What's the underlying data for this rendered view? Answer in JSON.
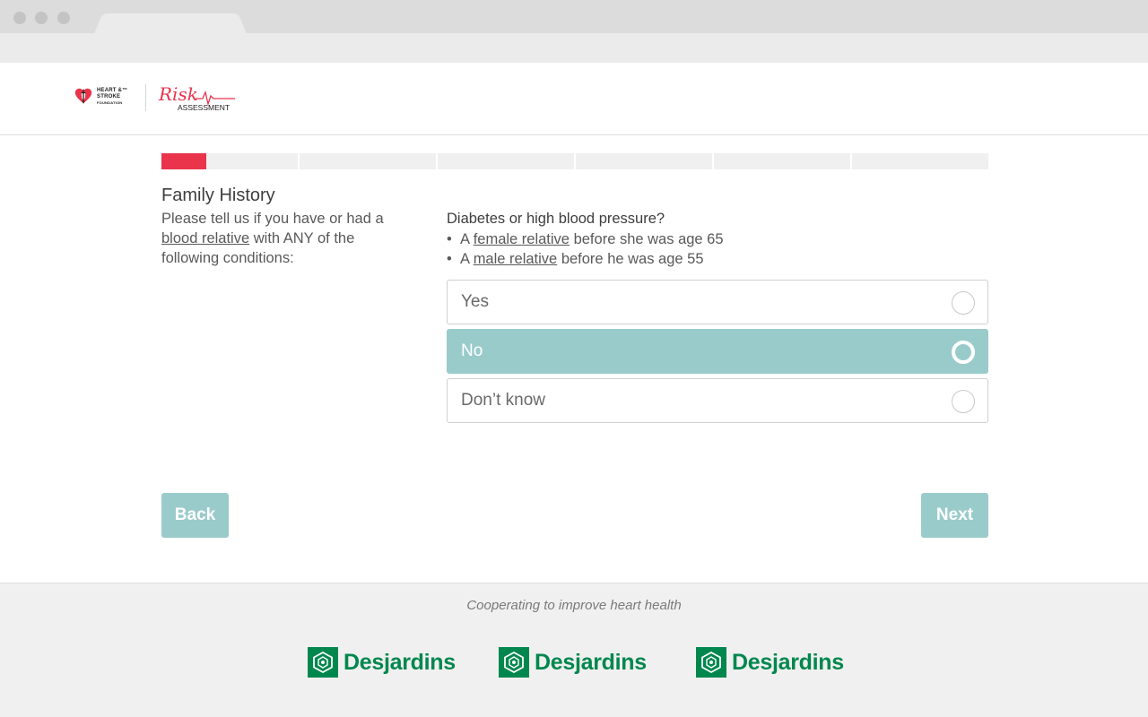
{
  "header": {
    "hsf_logo_lines": [
      "HEART &™",
      "STROKE",
      "FOUNDATION"
    ],
    "risk_logo_script": "Risk",
    "risk_logo_sub": "ASSESSMENT"
  },
  "progress": {
    "segments": 6,
    "current_fraction_of_first_segment": 0.33,
    "fill_color": "#e9344c"
  },
  "section": {
    "title": "Family History",
    "desc_part1": "Please tell us if you have or had a ",
    "desc_link": "blood relative",
    "desc_part2": " with ANY of the following conditions:"
  },
  "question": {
    "title": "Diabetes or high blood pressure?",
    "bullet1_pre": "A ",
    "bullet1_link": "female relative",
    "bullet1_post": " before she was age 65",
    "bullet2_pre": "A ",
    "bullet2_link": "male relative",
    "bullet2_post": " before he was age 55"
  },
  "options": [
    {
      "label": "Yes",
      "selected": false
    },
    {
      "label": "No",
      "selected": true
    },
    {
      "label": "Don’t know",
      "selected": false
    }
  ],
  "nav": {
    "back_label": "Back",
    "next_label": "Next"
  },
  "footer": {
    "tagline": "Cooperating to improve heart health",
    "sponsors": [
      "Desjardins",
      "Desjardins",
      "Desjardins"
    ]
  },
  "colors": {
    "accent": "#9acbcb",
    "brand_red": "#e9344c",
    "sponsor_green": "#00874e"
  }
}
